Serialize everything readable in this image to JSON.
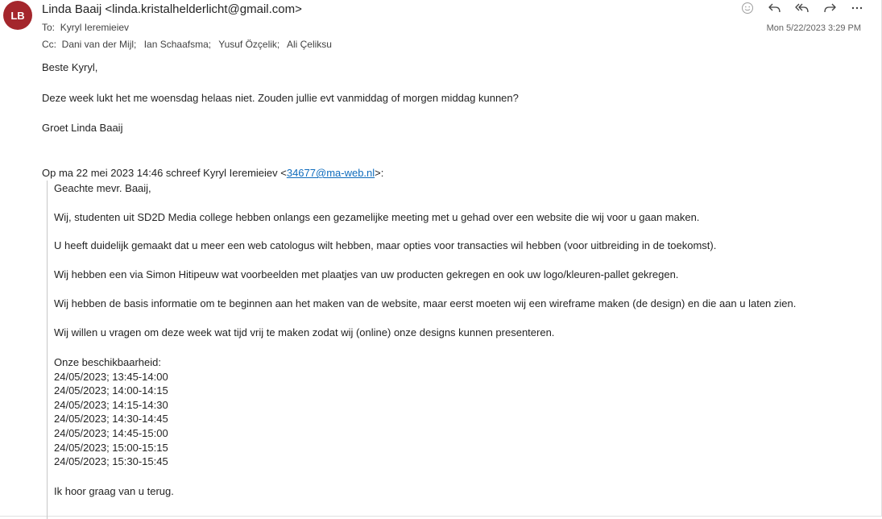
{
  "header": {
    "avatar_initials": "LB",
    "avatar_color": "#a4262c",
    "sender": "Linda Baaij <linda.kristalhelderlicht@gmail.com>",
    "to_label": "To:",
    "to": "Kyryl Ieremieiev",
    "cc_label": "Cc:",
    "cc": [
      "Dani van der Mijl;",
      "Ian Schaafsma;",
      "Yusuf Özçelik;",
      "Ali Çeliksu"
    ],
    "date": "Mon 5/22/2023 3:29 PM",
    "actions": [
      "emoji-icon",
      "reply-icon",
      "reply-all-icon",
      "forward-icon",
      "more-icon"
    ]
  },
  "message": {
    "greeting": "Beste Kyryl,",
    "text": "Deze week lukt het me woensdag helaas niet. Zouden jullie evt vanmiddag of morgen middag kunnen?",
    "signoff": "Groet Linda Baaij"
  },
  "quote": {
    "header_prefix": "Op ma 22 mei 2023 14:46 schreef Kyryl Ieremieiev <",
    "header_link": "34677@ma-web.nl",
    "header_suffix": ">:",
    "greeting": "Geachte mevr. Baaij,",
    "p1": "Wij, studenten uit SD2D Media college hebben onlangs een gezamelijke meeting met u gehad over een website die wij voor u gaan maken.",
    "p2": "U heeft duidelijk gemaakt dat u meer een web catologus wilt hebben, maar opties voor transacties wil hebben (voor uitbreiding in de toekomst).",
    "p3": "Wij hebben een via Simon Hitipeuw wat voorbeelden met plaatjes van uw producten gekregen en ook uw logo/kleuren-pallet gekregen.",
    "p4": "Wij hebben de basis informatie om te beginnen aan het maken van de website, maar eerst moeten wij een wireframe maken (de design) en die aan u laten zien.",
    "p5": "Wij willen u vragen om deze week wat tijd vrij te maken zodat wij (online) onze designs kunnen presenteren.",
    "availability_label": "Onze beschikbaarheid:",
    "slots": [
      "24/05/2023; 13:45-14:00",
      "24/05/2023; 14:00-14:15",
      "24/05/2023; 14:15-14:30",
      "24/05/2023; 14:30-14:45",
      "24/05/2023; 14:45-15:00",
      "24/05/2023; 15:00-15:15",
      "24/05/2023; 15:30-15:45"
    ],
    "closing": "Ik hoor graag van u terug."
  }
}
